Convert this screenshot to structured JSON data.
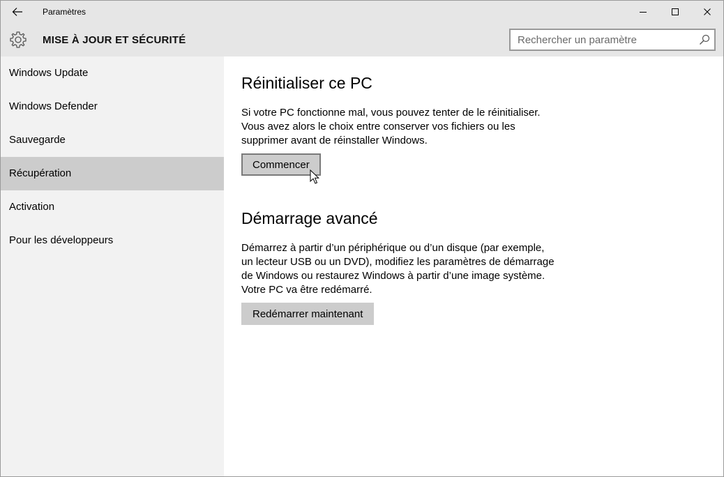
{
  "window": {
    "title": "Paramètres"
  },
  "header": {
    "title": "MISE À JOUR ET SÉCURITÉ",
    "search_placeholder": "Rechercher un paramètre"
  },
  "sidebar": {
    "items": [
      {
        "label": "Windows Update",
        "selected": false
      },
      {
        "label": "Windows Defender",
        "selected": false
      },
      {
        "label": "Sauvegarde",
        "selected": false
      },
      {
        "label": "Récupération",
        "selected": true
      },
      {
        "label": "Activation",
        "selected": false
      },
      {
        "label": "Pour les développeurs",
        "selected": false
      }
    ]
  },
  "main": {
    "reset": {
      "title": "Réinitialiser ce PC",
      "description": "Si votre PC fonctionne mal, vous pouvez tenter de le réinitialiser. Vous avez alors le choix entre conserver vos fichiers ou les supprimer avant de réinstaller Windows.",
      "button_label": "Commencer"
    },
    "advanced": {
      "title": "Démarrage avancé",
      "description": "Démarrez à partir d’un périphérique ou d’un disque (par exemple, un lecteur USB ou un DVD), modifiez les paramètres de démarrage de Windows ou restaurez Windows à partir d’une image système. Votre PC va être redémarré.",
      "button_label": "Redémarrer maintenant"
    }
  },
  "icons": {
    "back": "back-arrow-icon",
    "settings": "gear-icon",
    "search": "search-icon",
    "minimize": "minimize-icon",
    "maximize": "maximize-icon",
    "close": "close-icon",
    "pointer": "mouse-pointer-icon"
  },
  "colors": {
    "chrome": "#e6e6e6",
    "sidebar": "#f2f2f2",
    "selected_item": "#cccccc",
    "button": "#cccccc"
  }
}
